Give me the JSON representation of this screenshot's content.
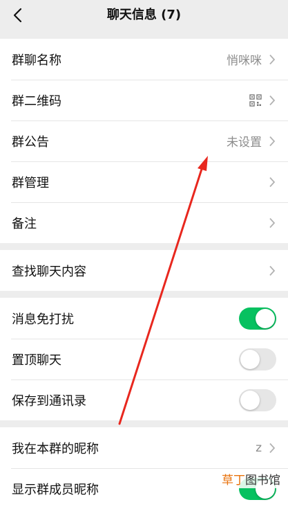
{
  "header": {
    "title": "聊天信息 (7)"
  },
  "group1": {
    "group_name": {
      "label": "群聊名称",
      "value": "悄咪咪"
    },
    "qrcode": {
      "label": "群二维码"
    },
    "announcement": {
      "label": "群公告",
      "value": "未设置"
    },
    "management": {
      "label": "群管理"
    },
    "remark": {
      "label": "备注"
    }
  },
  "group2": {
    "search": {
      "label": "查找聊天内容"
    }
  },
  "group3": {
    "mute": {
      "label": "消息免打扰",
      "enabled": true
    },
    "pin": {
      "label": "置顶聊天",
      "enabled": false
    },
    "save_contacts": {
      "label": "保存到通讯录",
      "enabled": false
    }
  },
  "group4": {
    "nickname": {
      "label": "我在本群的昵称",
      "value": "z"
    },
    "show_nicknames": {
      "label": "显示群成员昵称",
      "enabled": true
    }
  },
  "watermark": {
    "accent": "草丁",
    "rest": "图书馆"
  },
  "colors": {
    "toggle_on": "#07c160",
    "annotation_arrow": "#e8271e",
    "background": "#ededed"
  }
}
